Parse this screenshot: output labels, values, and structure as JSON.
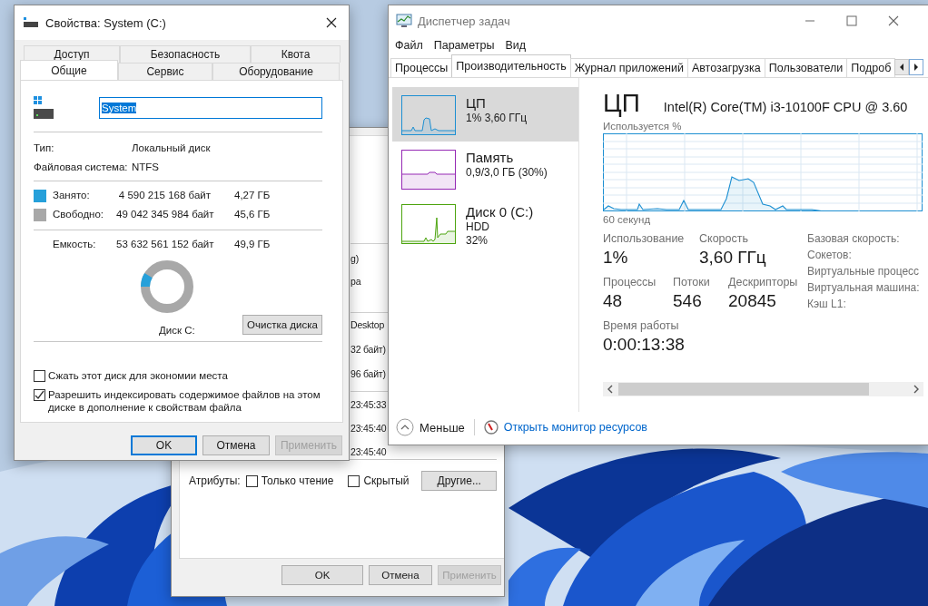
{
  "properties_dialog": {
    "title": "Свойства: System (C:)",
    "tabs_row_1": [
      {
        "label": "Доступ",
        "selected": false
      },
      {
        "label": "Безопасность",
        "selected": false
      },
      {
        "label": "Квота",
        "selected": false
      }
    ],
    "tabs_row_2": [
      {
        "label": "Общие",
        "selected": true
      },
      {
        "label": "Сервис",
        "selected": false
      },
      {
        "label": "Оборудование",
        "selected": false
      }
    ],
    "name_field": {
      "value": "System"
    },
    "info": [
      {
        "label": "Тип:",
        "value": "Локальный диск"
      },
      {
        "label": "Файловая система:",
        "value": "NTFS"
      }
    ],
    "usage": [
      {
        "label": "Занято:",
        "bytes": "4 590 215 168 байт",
        "size": "4,27 ГБ",
        "color": "#26a0da"
      },
      {
        "label": "Свободно:",
        "bytes": "49 042 345 984 байт",
        "size": "45,6 ГБ",
        "color": "#a8a8a8"
      }
    ],
    "capacity": {
      "label": "Емкость:",
      "bytes": "53 632 561 152 байт",
      "size": "49,9 ГБ"
    },
    "donut": {
      "level": 0.086
    },
    "drive_label": "Диск C:",
    "cleanup_button": "Очистка диска",
    "options": [
      {
        "label": "Сжать этот диск для экономии места",
        "checked": false
      },
      {
        "label": "Разрешить индексировать содержимое файлов на этом диске в дополнение к свойствам файла",
        "checked": true
      }
    ],
    "buttons": [
      {
        "label": "OK",
        "default": true,
        "disabled": false
      },
      {
        "label": "Отмена",
        "default": false,
        "disabled": false
      },
      {
        "label": "Применить",
        "default": false,
        "disabled": true
      }
    ]
  },
  "back_dialog": {
    "fragments_1": [
      "g)",
      "pa"
    ],
    "fragments_2": [
      "Desktop",
      "32 байт)",
      "96 байт)"
    ],
    "fragments_3": [
      "23:45:33",
      "23:45:40",
      "23:45:40"
    ],
    "attributes_label": "Атрибуты:",
    "attributes": [
      {
        "label": "Только чтение",
        "checked": false
      },
      {
        "label": "Скрытый",
        "checked": false
      }
    ],
    "other_button": "Другие...",
    "buttons": [
      {
        "label": "OK",
        "disabled": false
      },
      {
        "label": "Отмена",
        "disabled": false
      },
      {
        "label": "Применить",
        "disabled": true
      }
    ]
  },
  "task_manager": {
    "title": "Диспетчер задач",
    "menu": [
      "Файл",
      "Параметры",
      "Вид"
    ],
    "tabs": [
      {
        "label": "Процессы",
        "selected": false
      },
      {
        "label": "Производительность",
        "selected": true
      },
      {
        "label": "Журнал приложений",
        "selected": false
      },
      {
        "label": "Автозагрузка",
        "selected": false
      },
      {
        "label": "Пользователи",
        "selected": false
      },
      {
        "label": "Подроб",
        "selected": false
      }
    ],
    "resources": [
      {
        "kind": "cpu",
        "name": "ЦП",
        "lines": [
          "1% 3,60 ГГц"
        ],
        "color": "#1c8fd2",
        "selected": true
      },
      {
        "kind": "memory",
        "name": "Память",
        "lines": [
          "0,9/3,0 ГБ (30%)"
        ],
        "color": "#9528b4",
        "selected": false
      },
      {
        "kind": "disk",
        "name": "Диск 0 (C:)",
        "lines": [
          "HDD",
          "32%"
        ],
        "color": "#4ca40e",
        "selected": false
      }
    ],
    "detail": {
      "heading": "ЦП",
      "model": "Intel(R) Core(TM) i3-10100F CPU @ 3.60",
      "graph_label": "Используется %",
      "time_span": "60 секунд",
      "stats": [
        {
          "label": "Использование",
          "value": "1%"
        },
        {
          "label": "Скорость",
          "value": "3,60 ГГц"
        }
      ],
      "stats_row_2": [
        {
          "label": "Процессы",
          "value": "48"
        },
        {
          "label": "Потоки",
          "value": "546"
        },
        {
          "label": "Дескрипторы",
          "value": "20845"
        }
      ],
      "uptime": {
        "label": "Время работы",
        "value": "0:00:13:38"
      },
      "specs": [
        "Базовая скорость:",
        "Сокетов:",
        "Виртуальные процесс",
        "Виртуальная машина:",
        "Кэш L1:"
      ]
    },
    "footer": {
      "less": "Меньше",
      "link": "Открыть монитор ресурсов"
    }
  }
}
